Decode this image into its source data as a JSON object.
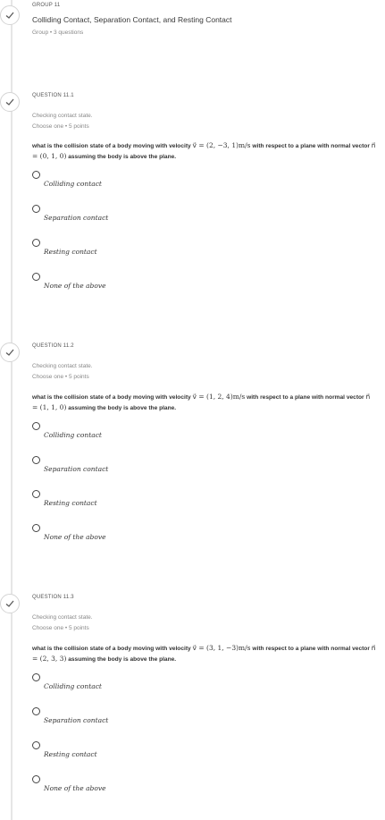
{
  "group": {
    "label": "GROUP 11",
    "title": "Colliding Contact, Separation Contact, and Resting Contact",
    "meta": "Group • 3 questions"
  },
  "questions": [
    {
      "label": "QUESTION 11.1",
      "sub1": "Checking contact state.",
      "sub2": "Choose one • 5 points",
      "text_pre": "what is the collision state of a body moving with velocity",
      "velocity_math": "v⃗ = (2, −3, 1)m/s",
      "text_mid": "with respect  to a plane with normal  vector",
      "normal_math": "n⃗ = (0, 1, 0)",
      "text_post": "assuming the body is above the plane.",
      "options": [
        "Colliding contact",
        "Separation contact",
        "Resting contact",
        "None of the above"
      ]
    },
    {
      "label": "QUESTION 11.2",
      "sub1": "Checking contact state.",
      "sub2": "Choose one • 5 points",
      "text_pre": "what is the collision state of a body moving with velocity",
      "velocity_math": "v⃗ = (1, 2, 4)m/s",
      "text_mid": "with respect  to a plane with normal  vector",
      "normal_math": "n⃗ = (1, 1, 0)",
      "text_post": "assuming the body is above the plane.",
      "options": [
        "Colliding contact",
        "Separation contact",
        "Resting contact",
        "None of the above"
      ]
    },
    {
      "label": "QUESTION 11.3",
      "sub1": "Checking contact state.",
      "sub2": "Choose one • 5 points",
      "text_pre": "what is the collision state of a body moving with velocity",
      "velocity_math": "v⃗ = (3, 1, −3)m/s",
      "text_mid": "with respect  to a plane with normal  vector",
      "normal_math": "n⃗ = (2, 3, 3)",
      "text_post": "assuming the body is above the plane.",
      "options": [
        "Colliding contact",
        "Separation contact",
        "Resting contact",
        "None of the above"
      ]
    }
  ],
  "colors": {
    "check": "#5a5a5a",
    "timeline": "#e6e6e6"
  },
  "icons": {
    "status": "checkmark-icon",
    "option": "radio-button-icon"
  }
}
